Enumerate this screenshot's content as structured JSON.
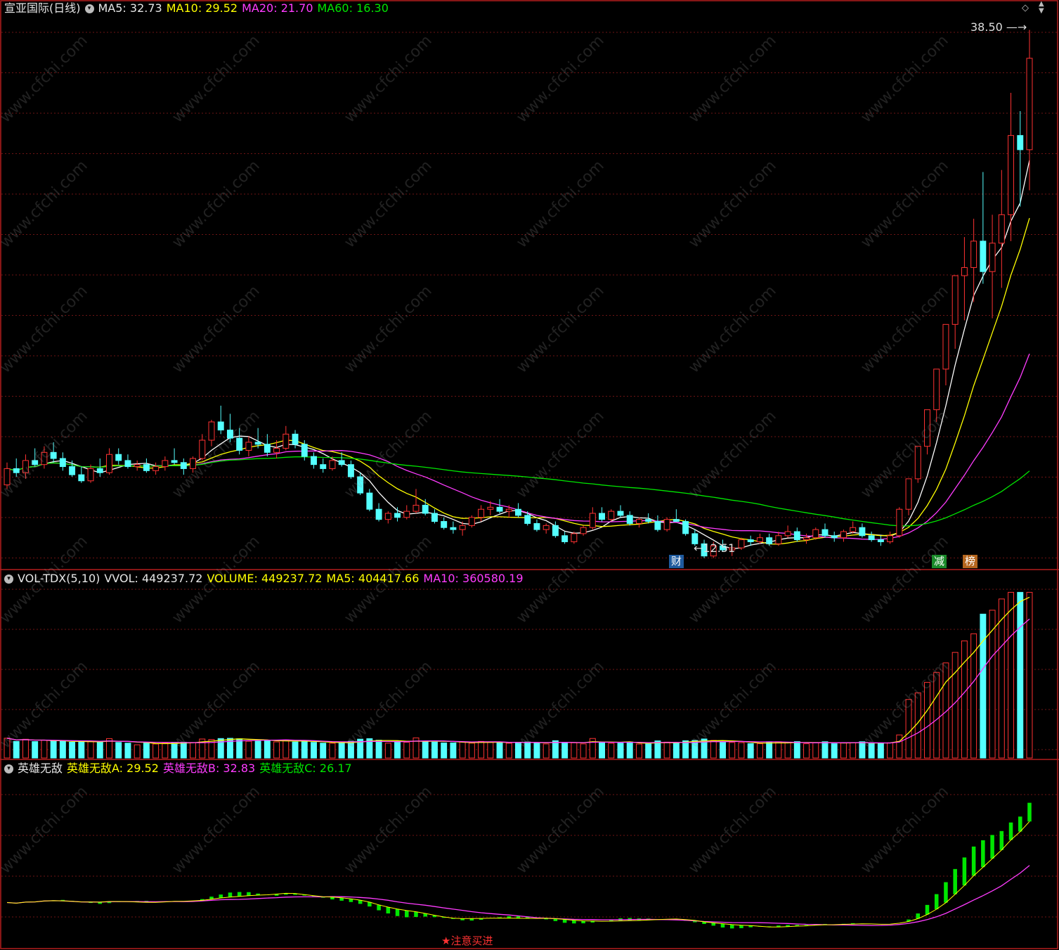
{
  "header": {
    "title": "宣亚国际(日线)",
    "ma5": "MA5: 32.73",
    "ma10": "MA10: 29.52",
    "ma20": "MA20: 21.70",
    "ma60": "MA60: 16.30"
  },
  "window_controls": {
    "diamond": "◇",
    "up": "▲",
    "down": "▼"
  },
  "price_panel": {
    "high_label": "38.50",
    "low_label": "12.51",
    "badges": [
      {
        "text": "财",
        "color": "#1e5a9e"
      },
      {
        "text": "减",
        "color": "#1a8a2a"
      },
      {
        "text": "榜",
        "color": "#b5651d"
      }
    ]
  },
  "volume_panel": {
    "name": "VOL-TDX(5,10)",
    "vvol": "VVOL: 449237.72",
    "volume": "VOLUME: 449237.72",
    "ma5": "MA5: 404417.66",
    "ma10": "MA10: 360580.19"
  },
  "indicator_panel": {
    "name": "英雄无敌",
    "a": "英雄无敌A: 29.52",
    "b": "英雄无敌B: 32.83",
    "c": "英雄无敌C: 26.17",
    "signal": "★注意买进"
  },
  "watermark": "www.cfchi.com",
  "colors": {
    "up": "#ff3232",
    "down": "#54ffff",
    "ma5": "#ffffff",
    "ma10": "#ffff00",
    "ma20": "#ff3cff",
    "ma60": "#00e600",
    "grid": "#6e1414",
    "border": "#b41e1e"
  },
  "chart_data": {
    "type": "candlestick",
    "ohlc": [
      [
        16.1,
        17.2,
        15.9,
        16.9
      ],
      [
        16.9,
        17.4,
        16.5,
        16.7
      ],
      [
        16.7,
        17.6,
        16.4,
        17.3
      ],
      [
        17.3,
        17.9,
        17.0,
        17.1
      ],
      [
        17.1,
        18.0,
        16.9,
        17.7
      ],
      [
        17.7,
        18.2,
        17.2,
        17.4
      ],
      [
        17.4,
        17.7,
        16.8,
        17.0
      ],
      [
        17.0,
        17.3,
        16.5,
        16.6
      ],
      [
        16.6,
        17.0,
        16.2,
        16.3
      ],
      [
        16.3,
        17.1,
        16.2,
        16.9
      ],
      [
        16.9,
        17.4,
        16.5,
        16.7
      ],
      [
        16.7,
        17.9,
        16.6,
        17.6
      ],
      [
        17.6,
        17.9,
        17.1,
        17.3
      ],
      [
        17.3,
        17.6,
        16.9,
        17.0
      ],
      [
        17.0,
        17.3,
        16.8,
        17.1
      ],
      [
        17.1,
        17.4,
        16.7,
        16.8
      ],
      [
        16.8,
        17.2,
        16.6,
        17.0
      ],
      [
        17.0,
        17.5,
        16.8,
        17.3
      ],
      [
        17.3,
        17.9,
        17.1,
        17.2
      ],
      [
        17.2,
        17.4,
        16.6,
        16.9
      ],
      [
        16.9,
        17.5,
        16.7,
        17.4
      ],
      [
        17.4,
        18.6,
        17.3,
        18.3
      ],
      [
        18.3,
        19.3,
        18.0,
        19.2
      ],
      [
        19.2,
        20.0,
        18.6,
        18.8
      ],
      [
        18.8,
        19.6,
        18.2,
        18.4
      ],
      [
        18.4,
        18.9,
        17.6,
        17.8
      ],
      [
        17.8,
        18.5,
        17.5,
        18.2
      ],
      [
        18.2,
        18.9,
        17.9,
        18.1
      ],
      [
        18.1,
        18.6,
        17.5,
        17.7
      ],
      [
        17.7,
        18.3,
        17.4,
        17.9
      ],
      [
        17.9,
        19.0,
        17.8,
        18.6
      ],
      [
        18.6,
        18.8,
        17.9,
        18.1
      ],
      [
        18.1,
        18.3,
        17.3,
        17.5
      ],
      [
        17.5,
        17.7,
        16.9,
        17.1
      ],
      [
        17.1,
        17.4,
        16.7,
        16.9
      ],
      [
        16.9,
        17.5,
        16.8,
        17.3
      ],
      [
        17.3,
        17.7,
        17.0,
        17.1
      ],
      [
        17.1,
        17.3,
        16.4,
        16.5
      ],
      [
        16.5,
        16.7,
        15.6,
        15.7
      ],
      [
        15.7,
        15.9,
        14.8,
        14.9
      ],
      [
        14.9,
        15.2,
        14.3,
        14.4
      ],
      [
        14.4,
        14.8,
        14.2,
        14.7
      ],
      [
        14.7,
        15.0,
        14.3,
        14.5
      ],
      [
        14.5,
        15.1,
        14.4,
        14.8
      ],
      [
        14.8,
        15.9,
        14.7,
        15.1
      ],
      [
        15.1,
        15.4,
        14.6,
        14.7
      ],
      [
        14.7,
        14.9,
        14.2,
        14.3
      ],
      [
        14.3,
        14.5,
        13.9,
        14.0
      ],
      [
        14.0,
        14.3,
        13.7,
        13.9
      ],
      [
        13.9,
        14.3,
        13.6,
        14.1
      ],
      [
        14.1,
        14.6,
        14.0,
        14.5
      ],
      [
        14.5,
        15.1,
        14.3,
        14.9
      ],
      [
        14.9,
        15.3,
        14.6,
        15.0
      ],
      [
        15.0,
        15.4,
        14.7,
        14.8
      ],
      [
        14.8,
        15.1,
        14.5,
        14.9
      ],
      [
        14.9,
        15.2,
        14.5,
        14.6
      ],
      [
        14.6,
        14.8,
        14.1,
        14.2
      ],
      [
        14.2,
        14.4,
        13.8,
        13.9
      ],
      [
        13.9,
        14.2,
        13.7,
        14.1
      ],
      [
        14.1,
        14.3,
        13.5,
        13.6
      ],
      [
        13.6,
        13.8,
        13.2,
        13.3
      ],
      [
        13.3,
        13.8,
        13.2,
        13.7
      ],
      [
        13.7,
        14.1,
        13.6,
        14.0
      ],
      [
        14.0,
        15.0,
        13.9,
        14.7
      ],
      [
        14.7,
        15.0,
        14.3,
        14.4
      ],
      [
        14.4,
        14.9,
        14.3,
        14.8
      ],
      [
        14.8,
        15.1,
        14.5,
        14.6
      ],
      [
        14.6,
        14.8,
        14.1,
        14.2
      ],
      [
        14.2,
        14.5,
        14.0,
        14.4
      ],
      [
        14.4,
        14.7,
        14.2,
        14.3
      ],
      [
        14.3,
        14.6,
        13.8,
        13.9
      ],
      [
        13.9,
        14.5,
        13.8,
        14.4
      ],
      [
        14.4,
        14.9,
        14.3,
        14.3
      ],
      [
        14.3,
        14.4,
        13.6,
        13.7
      ],
      [
        13.7,
        13.9,
        13.1,
        13.2
      ],
      [
        13.2,
        13.4,
        12.5,
        12.6
      ],
      [
        12.6,
        13.3,
        12.5,
        13.1
      ],
      [
        13.1,
        13.4,
        12.8,
        12.9
      ],
      [
        12.9,
        13.2,
        12.6,
        13.0
      ],
      [
        13.0,
        13.5,
        12.9,
        13.4
      ],
      [
        13.4,
        13.6,
        13.1,
        13.3
      ],
      [
        13.3,
        13.7,
        13.2,
        13.5
      ],
      [
        13.5,
        13.7,
        13.1,
        13.2
      ],
      [
        13.2,
        13.8,
        13.1,
        13.6
      ],
      [
        13.6,
        14.1,
        13.5,
        13.8
      ],
      [
        13.8,
        14.0,
        13.3,
        13.4
      ],
      [
        13.4,
        13.7,
        13.2,
        13.5
      ],
      [
        13.5,
        14.0,
        13.4,
        13.9
      ],
      [
        13.9,
        14.2,
        13.5,
        13.6
      ],
      [
        13.6,
        13.8,
        13.3,
        13.5
      ],
      [
        13.5,
        13.9,
        13.3,
        13.8
      ],
      [
        13.8,
        14.3,
        13.7,
        14.0
      ],
      [
        14.0,
        14.2,
        13.5,
        13.6
      ],
      [
        13.6,
        13.8,
        13.3,
        13.4
      ],
      [
        13.4,
        13.6,
        13.1,
        13.3
      ],
      [
        13.3,
        13.8,
        13.2,
        13.6
      ],
      [
        13.6,
        15.0,
        13.5,
        14.9
      ],
      [
        14.9,
        16.4,
        14.6,
        16.4
      ],
      [
        16.4,
        18.0,
        16.2,
        18.0
      ],
      [
        18.0,
        19.8,
        17.6,
        19.8
      ],
      [
        19.8,
        21.8,
        19.2,
        21.8
      ],
      [
        21.8,
        24.0,
        21.0,
        24.0
      ],
      [
        24.0,
        26.4,
        22.8,
        26.4
      ],
      [
        26.4,
        28.3,
        24.2,
        26.8
      ],
      [
        26.8,
        29.2,
        25.1,
        28.1
      ],
      [
        28.1,
        31.5,
        26.0,
        26.6
      ],
      [
        26.6,
        29.4,
        24.3,
        28.0
      ],
      [
        28.0,
        31.6,
        25.8,
        29.4
      ],
      [
        29.4,
        35.4,
        28.1,
        33.3
      ],
      [
        33.3,
        34.5,
        29.8,
        32.6
      ],
      [
        32.6,
        38.5,
        30.6,
        37.1
      ]
    ],
    "volume_range": [
      0,
      1100000
    ],
    "indicator_series": [
      "英雄无敌A",
      "英雄无敌B",
      "英雄无敌C"
    ]
  }
}
